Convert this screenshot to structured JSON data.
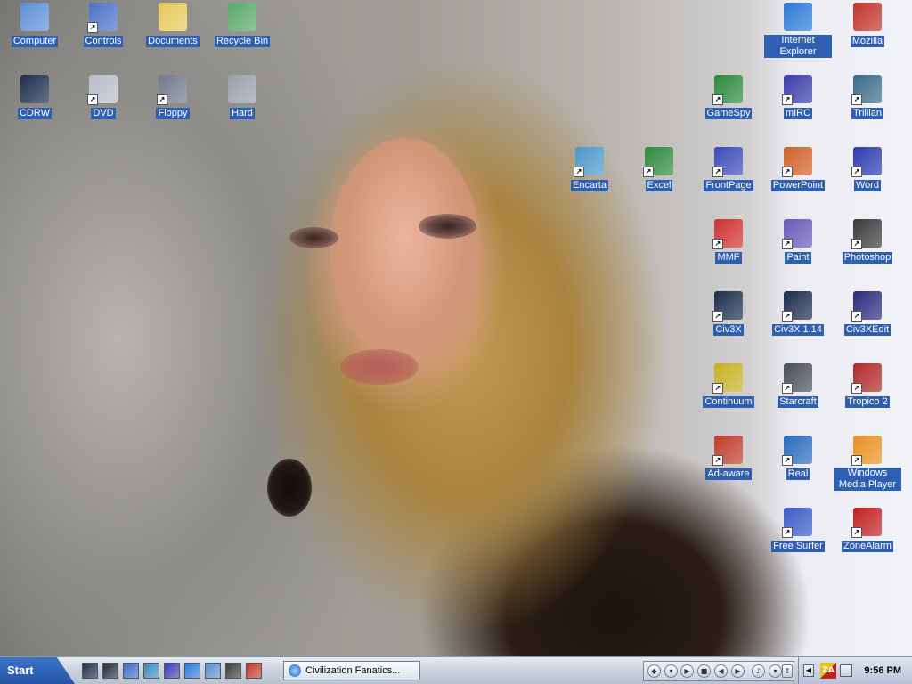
{
  "desktop": {
    "icons": [
      {
        "label": "Computer",
        "icon": "my-computer-icon",
        "color": "#5d8ed8"
      },
      {
        "label": "Controls",
        "icon": "control-panel-icon",
        "color": "#4a72c8"
      },
      {
        "label": "Documents",
        "icon": "folder-icon",
        "color": "#e7c85a"
      },
      {
        "label": "Recycle Bin",
        "icon": "recycle-bin-icon",
        "color": "#5aa86a"
      },
      {
        "label": "CDRW",
        "icon": "civ3-cdrw-icon",
        "color": "#1b2c4c"
      },
      {
        "label": "DVD",
        "icon": "dvd-drive-icon",
        "color": "#b7bcc6"
      },
      {
        "label": "Floppy",
        "icon": "floppy-drive-icon",
        "color": "#707a8c"
      },
      {
        "label": "Hard",
        "icon": "hard-drive-icon",
        "color": "#9aa0a8"
      },
      {
        "label": "Internet Explorer",
        "icon": "internet-explorer-icon",
        "color": "#2b79d6"
      },
      {
        "label": "Mozilla",
        "icon": "mozilla-icon",
        "color": "#c0342c"
      },
      {
        "label": "GameSpy",
        "icon": "gamespy-icon",
        "color": "#2a8a3a"
      },
      {
        "label": "mIRC",
        "icon": "mirc-icon",
        "color": "#3a3aa8"
      },
      {
        "label": "Trillian",
        "icon": "trillian-icon",
        "color": "#3a6a8a"
      },
      {
        "label": "Encarta",
        "icon": "encarta-icon",
        "color": "#4a98c8"
      },
      {
        "label": "Excel",
        "icon": "excel-icon",
        "color": "#2c8a3c"
      },
      {
        "label": "FrontPage",
        "icon": "frontpage-icon",
        "color": "#3a4ab8"
      },
      {
        "label": "PowerPoint",
        "icon": "powerpoint-icon",
        "color": "#d0602a"
      },
      {
        "label": "Word",
        "icon": "word-icon",
        "color": "#2a3ab0"
      },
      {
        "label": "MMF",
        "icon": "mmf-icon",
        "color": "#d03030"
      },
      {
        "label": "Paint",
        "icon": "paint-icon",
        "color": "#6a58b8"
      },
      {
        "label": "Photoshop",
        "icon": "photoshop-icon",
        "color": "#3a3a3a"
      },
      {
        "label": "Civ3X",
        "icon": "civ3x-icon",
        "color": "#1b2c4c"
      },
      {
        "label": "Civ3X 1.14",
        "icon": "civ3x-114-icon",
        "color": "#1b2c4c"
      },
      {
        "label": "Civ3XEdit",
        "icon": "civ3xedit-icon",
        "color": "#2a2a80"
      },
      {
        "label": "Continuum",
        "icon": "continuum-icon",
        "color": "#c8b020"
      },
      {
        "label": "Starcraft",
        "icon": "starcraft-icon",
        "color": "#4a4e58"
      },
      {
        "label": "Tropico 2",
        "icon": "tropico-icon",
        "color": "#b02828"
      },
      {
        "label": "Ad-aware",
        "icon": "ad-aware-icon",
        "color": "#c03a2a"
      },
      {
        "label": "Real",
        "icon": "realplayer-icon",
        "color": "#2a6ac0"
      },
      {
        "label": "Windows Media Player",
        "icon": "windows-media-player-icon",
        "color": "#e89020"
      },
      {
        "label": "Free Surfer",
        "icon": "free-surfer-icon",
        "color": "#3a5ac8"
      },
      {
        "label": "ZoneAlarm",
        "icon": "zonealarm-icon",
        "color": "#c02020"
      }
    ]
  },
  "taskbar": {
    "start_label": "Start",
    "quick_launch": [
      {
        "icon": "civ3-quicklaunch-icon",
        "color": "#1b2c4c"
      },
      {
        "icon": "civ3x-quicklaunch-icon",
        "color": "#222a3a"
      },
      {
        "icon": "frontpage-quicklaunch-icon",
        "color": "#3a6ac8"
      },
      {
        "icon": "encarta-quicklaunch-icon",
        "color": "#3a88c0"
      },
      {
        "icon": "tropico-quicklaunch-icon",
        "color": "#3a3ab8"
      },
      {
        "icon": "internet-explorer-quicklaunch-icon",
        "color": "#2a79d6"
      },
      {
        "icon": "desktop-quicklaunch-icon",
        "color": "#5a8ed0"
      },
      {
        "icon": "photoshop-quicklaunch-icon",
        "color": "#3a3a3a"
      },
      {
        "icon": "tropico2-quicklaunch-icon",
        "color": "#c03a2a"
      }
    ],
    "task_window_label": "Civilization Fanatics...",
    "tray_zonealarm": "ZA",
    "clock": "9:56 PM"
  }
}
